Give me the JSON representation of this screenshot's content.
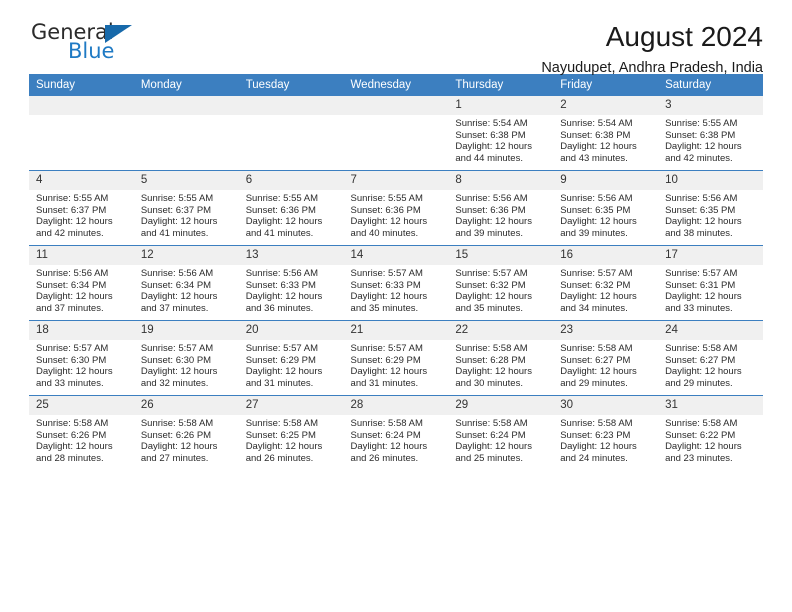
{
  "branding": {
    "logo_primary": "General",
    "logo_secondary": "Blue",
    "accent_color": "#1f7ac4",
    "header_color": "#3c7fc0"
  },
  "header": {
    "title": "August 2024",
    "subtitle": "Nayudupet, Andhra Pradesh, India"
  },
  "weekdays": [
    "Sunday",
    "Monday",
    "Tuesday",
    "Wednesday",
    "Thursday",
    "Friday",
    "Saturday"
  ],
  "labels": {
    "sunrise": "Sunrise:",
    "sunset": "Sunset:",
    "daylight": "Daylight:"
  },
  "weeks": [
    [
      {
        "day": "",
        "empty": true
      },
      {
        "day": "",
        "empty": true
      },
      {
        "day": "",
        "empty": true
      },
      {
        "day": "",
        "empty": true
      },
      {
        "day": "1",
        "sunrise": "Sunrise: 5:54 AM",
        "sunset": "Sunset: 6:38 PM",
        "daylight1": "Daylight: 12 hours",
        "daylight2": "and 44 minutes."
      },
      {
        "day": "2",
        "sunrise": "Sunrise: 5:54 AM",
        "sunset": "Sunset: 6:38 PM",
        "daylight1": "Daylight: 12 hours",
        "daylight2": "and 43 minutes."
      },
      {
        "day": "3",
        "sunrise": "Sunrise: 5:55 AM",
        "sunset": "Sunset: 6:38 PM",
        "daylight1": "Daylight: 12 hours",
        "daylight2": "and 42 minutes."
      }
    ],
    [
      {
        "day": "4",
        "sunrise": "Sunrise: 5:55 AM",
        "sunset": "Sunset: 6:37 PM",
        "daylight1": "Daylight: 12 hours",
        "daylight2": "and 42 minutes."
      },
      {
        "day": "5",
        "sunrise": "Sunrise: 5:55 AM",
        "sunset": "Sunset: 6:37 PM",
        "daylight1": "Daylight: 12 hours",
        "daylight2": "and 41 minutes."
      },
      {
        "day": "6",
        "sunrise": "Sunrise: 5:55 AM",
        "sunset": "Sunset: 6:36 PM",
        "daylight1": "Daylight: 12 hours",
        "daylight2": "and 41 minutes."
      },
      {
        "day": "7",
        "sunrise": "Sunrise: 5:55 AM",
        "sunset": "Sunset: 6:36 PM",
        "daylight1": "Daylight: 12 hours",
        "daylight2": "and 40 minutes."
      },
      {
        "day": "8",
        "sunrise": "Sunrise: 5:56 AM",
        "sunset": "Sunset: 6:36 PM",
        "daylight1": "Daylight: 12 hours",
        "daylight2": "and 39 minutes."
      },
      {
        "day": "9",
        "sunrise": "Sunrise: 5:56 AM",
        "sunset": "Sunset: 6:35 PM",
        "daylight1": "Daylight: 12 hours",
        "daylight2": "and 39 minutes."
      },
      {
        "day": "10",
        "sunrise": "Sunrise: 5:56 AM",
        "sunset": "Sunset: 6:35 PM",
        "daylight1": "Daylight: 12 hours",
        "daylight2": "and 38 minutes."
      }
    ],
    [
      {
        "day": "11",
        "sunrise": "Sunrise: 5:56 AM",
        "sunset": "Sunset: 6:34 PM",
        "daylight1": "Daylight: 12 hours",
        "daylight2": "and 37 minutes."
      },
      {
        "day": "12",
        "sunrise": "Sunrise: 5:56 AM",
        "sunset": "Sunset: 6:34 PM",
        "daylight1": "Daylight: 12 hours",
        "daylight2": "and 37 minutes."
      },
      {
        "day": "13",
        "sunrise": "Sunrise: 5:56 AM",
        "sunset": "Sunset: 6:33 PM",
        "daylight1": "Daylight: 12 hours",
        "daylight2": "and 36 minutes."
      },
      {
        "day": "14",
        "sunrise": "Sunrise: 5:57 AM",
        "sunset": "Sunset: 6:33 PM",
        "daylight1": "Daylight: 12 hours",
        "daylight2": "and 35 minutes."
      },
      {
        "day": "15",
        "sunrise": "Sunrise: 5:57 AM",
        "sunset": "Sunset: 6:32 PM",
        "daylight1": "Daylight: 12 hours",
        "daylight2": "and 35 minutes."
      },
      {
        "day": "16",
        "sunrise": "Sunrise: 5:57 AM",
        "sunset": "Sunset: 6:32 PM",
        "daylight1": "Daylight: 12 hours",
        "daylight2": "and 34 minutes."
      },
      {
        "day": "17",
        "sunrise": "Sunrise: 5:57 AM",
        "sunset": "Sunset: 6:31 PM",
        "daylight1": "Daylight: 12 hours",
        "daylight2": "and 33 minutes."
      }
    ],
    [
      {
        "day": "18",
        "sunrise": "Sunrise: 5:57 AM",
        "sunset": "Sunset: 6:30 PM",
        "daylight1": "Daylight: 12 hours",
        "daylight2": "and 33 minutes."
      },
      {
        "day": "19",
        "sunrise": "Sunrise: 5:57 AM",
        "sunset": "Sunset: 6:30 PM",
        "daylight1": "Daylight: 12 hours",
        "daylight2": "and 32 minutes."
      },
      {
        "day": "20",
        "sunrise": "Sunrise: 5:57 AM",
        "sunset": "Sunset: 6:29 PM",
        "daylight1": "Daylight: 12 hours",
        "daylight2": "and 31 minutes."
      },
      {
        "day": "21",
        "sunrise": "Sunrise: 5:57 AM",
        "sunset": "Sunset: 6:29 PM",
        "daylight1": "Daylight: 12 hours",
        "daylight2": "and 31 minutes."
      },
      {
        "day": "22",
        "sunrise": "Sunrise: 5:58 AM",
        "sunset": "Sunset: 6:28 PM",
        "daylight1": "Daylight: 12 hours",
        "daylight2": "and 30 minutes."
      },
      {
        "day": "23",
        "sunrise": "Sunrise: 5:58 AM",
        "sunset": "Sunset: 6:27 PM",
        "daylight1": "Daylight: 12 hours",
        "daylight2": "and 29 minutes."
      },
      {
        "day": "24",
        "sunrise": "Sunrise: 5:58 AM",
        "sunset": "Sunset: 6:27 PM",
        "daylight1": "Daylight: 12 hours",
        "daylight2": "and 29 minutes."
      }
    ],
    [
      {
        "day": "25",
        "sunrise": "Sunrise: 5:58 AM",
        "sunset": "Sunset: 6:26 PM",
        "daylight1": "Daylight: 12 hours",
        "daylight2": "and 28 minutes."
      },
      {
        "day": "26",
        "sunrise": "Sunrise: 5:58 AM",
        "sunset": "Sunset: 6:26 PM",
        "daylight1": "Daylight: 12 hours",
        "daylight2": "and 27 minutes."
      },
      {
        "day": "27",
        "sunrise": "Sunrise: 5:58 AM",
        "sunset": "Sunset: 6:25 PM",
        "daylight1": "Daylight: 12 hours",
        "daylight2": "and 26 minutes."
      },
      {
        "day": "28",
        "sunrise": "Sunrise: 5:58 AM",
        "sunset": "Sunset: 6:24 PM",
        "daylight1": "Daylight: 12 hours",
        "daylight2": "and 26 minutes."
      },
      {
        "day": "29",
        "sunrise": "Sunrise: 5:58 AM",
        "sunset": "Sunset: 6:24 PM",
        "daylight1": "Daylight: 12 hours",
        "daylight2": "and 25 minutes."
      },
      {
        "day": "30",
        "sunrise": "Sunrise: 5:58 AM",
        "sunset": "Sunset: 6:23 PM",
        "daylight1": "Daylight: 12 hours",
        "daylight2": "and 24 minutes."
      },
      {
        "day": "31",
        "sunrise": "Sunrise: 5:58 AM",
        "sunset": "Sunset: 6:22 PM",
        "daylight1": "Daylight: 12 hours",
        "daylight2": "and 23 minutes."
      }
    ]
  ]
}
